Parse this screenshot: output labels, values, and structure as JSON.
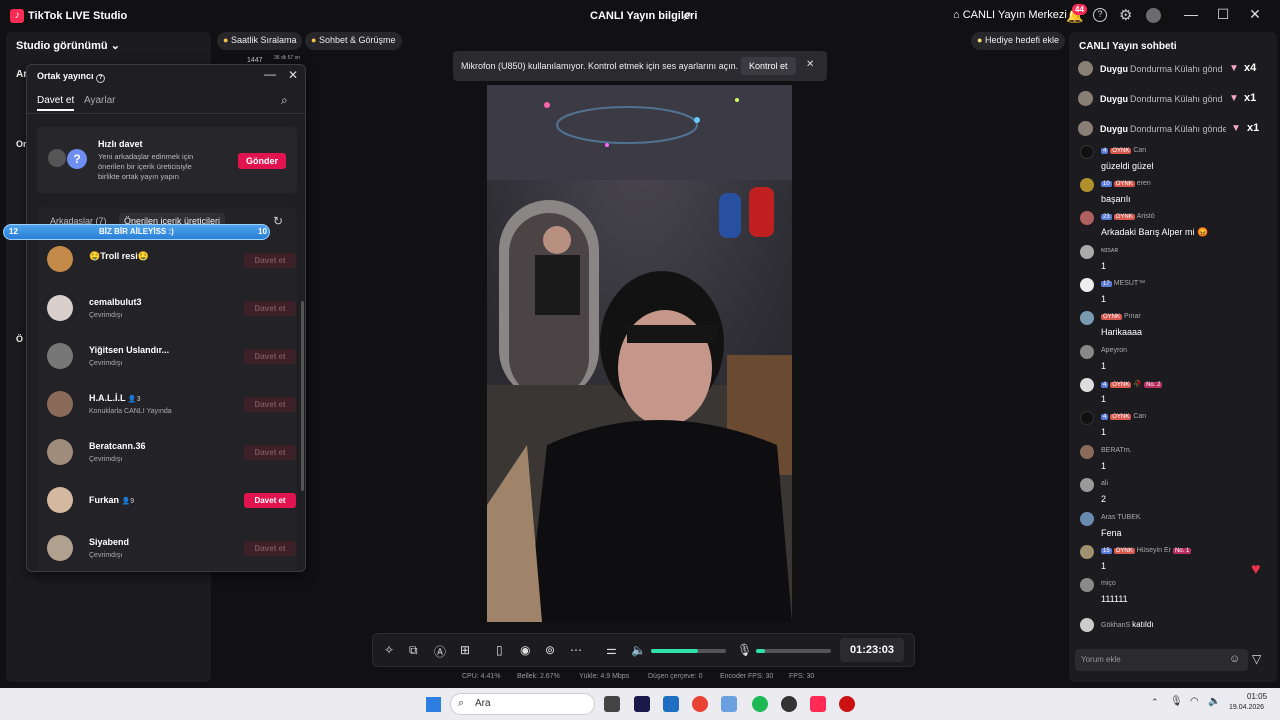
{
  "titlebar": {
    "app_title": "TikTok LIVE Studio",
    "center_title": "CANLI Yayın bilgileri",
    "live_center": "CANLI Yayın Merkezi",
    "bell_badge": "44"
  },
  "left": {
    "studio_view": "Studio görünümü"
  },
  "pills": {
    "hourly": "Saatlik Sıralama",
    "chat_call": "Sohbet & Görüşme",
    "gift_goal": "Hediye hedefi ekle"
  },
  "popup": {
    "title": "Ortak yayıncı",
    "tabs": [
      "Davet et",
      "Ayarlar"
    ],
    "quick_title": "Hızlı davet",
    "quick_desc": "Yeni arkadaşlar edinmek için önerilen bir içerik üreticisiyle birlikte ortak yayın yapın",
    "send": "Gönder",
    "sub_tabs": [
      "Arkadaşlar (7)",
      "Önerilen içerik üreticileri"
    ],
    "banner": {
      "left": "12",
      "title": "BİZ BİR AİLEYİSS :)",
      "right": "10"
    },
    "rows": [
      {
        "name": "🤤Troll resi🤤",
        "sub": "",
        "btn": "Davet et",
        "active": false,
        "av": "#c48a4a"
      },
      {
        "name": "cemalbulut3",
        "sub": "Çevrimdışı",
        "btn": "Davet et",
        "active": false,
        "av": "#d9d0cc"
      },
      {
        "name": "Yiğitsen Uslandır...",
        "sub": "Çevrimdışı",
        "btn": "Davet et",
        "active": false,
        "av": "#777"
      },
      {
        "name": "H.A.L.İ.L",
        "sub": "Konuklarla CANLI Yayında",
        "badge": "3",
        "btn": "Davet et",
        "active": false,
        "av": "#8a6b5a"
      },
      {
        "name": "Beratcann.36",
        "sub": "Çevrimdışı",
        "btn": "Davet et",
        "active": false,
        "av": "#a08c7a"
      },
      {
        "name": "Furkan",
        "sub": "",
        "badge": "9",
        "btn": "Davet et",
        "active": true,
        "av": "#d4b8a0"
      },
      {
        "name": "Siyabend",
        "sub": "Çevrimdışı",
        "btn": "Davet et",
        "active": false,
        "av": "#b0a090"
      }
    ]
  },
  "partial": {
    "n1": "1447",
    "t1": "36 dk 57 sn"
  },
  "notice": {
    "text": "Mikrofon (U850) kullanılamıyor. Kontrol etmek için ses ayarlarını açın.",
    "button": "Kontrol et"
  },
  "controls": {
    "timer": "01:23:03",
    "volume_level": 0.62,
    "mic_level": 0.12
  },
  "stats": {
    "cpu": "CPU: 4.41%",
    "mem": "Bellek: 2.67%",
    "upload": "Yükle: 4.9 Mbps",
    "dropped": "Düşen çerçeve: 0",
    "encoder": "Encoder FPS: 30",
    "fps": "FPS: 30"
  },
  "chat": {
    "title": "CANLI Yayın sohbeti",
    "gifts": [
      {
        "name": "Duygu",
        "text": "Dondurma Külahı gönd",
        "count": "x4"
      },
      {
        "name": "Duygu",
        "text": "Dondurma Külahı gönd",
        "count": "x1"
      },
      {
        "name": "Duygu",
        "text": "Dondurma Külahı gönde",
        "count": "x1"
      }
    ],
    "messages": [
      {
        "lvl": "4",
        "fan": "OYNK",
        "user": "Can",
        "text": "güzeldi güzel",
        "av": "#111"
      },
      {
        "lvl": "10",
        "fan": "OYNK",
        "user": "eren",
        "text": "başarılı",
        "av": "#b0902a"
      },
      {
        "lvl": "23",
        "fan": "OYNK",
        "user": "Aristó",
        "text": "Arkadaki Barış Alper mi 😡",
        "av": "#b06060"
      },
      {
        "user": "ɴɪsᴀʀ",
        "text": "1",
        "av": "#aaa"
      },
      {
        "lvl": "17",
        "user": "MESUT™",
        "text": "1",
        "av": "#eee"
      },
      {
        "fan": "OYNK",
        "user": "Pınar",
        "text": "Harikaaaa",
        "av": "#7a9ab0"
      },
      {
        "user": "Apeyron",
        "text": "1",
        "av": "#888"
      },
      {
        "lvl": "4",
        "fan": "OYNK",
        "user": "🥀",
        "rank": "No. 2",
        "text": "1",
        "av": "#ddd"
      },
      {
        "lvl": "4",
        "fan": "OYNK",
        "user": "Can",
        "text": "1",
        "av": "#111"
      },
      {
        "user": "BERATm.",
        "text": "1",
        "av": "#8a6b5a"
      },
      {
        "user": "ali",
        "text": "2",
        "av": "#999"
      },
      {
        "user": "Aras TUBEK",
        "text": "Fena",
        "av": "#6a8ab0"
      },
      {
        "lvl": "15",
        "fan": "OYNK",
        "user": "Hüseyin Er",
        "rank": "No. 1",
        "text": "1",
        "av": "#a09070"
      },
      {
        "user": "miço",
        "text": "111111",
        "av": "#8a8a8a"
      }
    ],
    "joined": {
      "user": "GökhanS",
      "text": "katıldı"
    },
    "input_placeholder": "Yorum ekle"
  },
  "taskbar": {
    "search": "Ara",
    "time": "01:05",
    "date": "19.04.2026"
  }
}
